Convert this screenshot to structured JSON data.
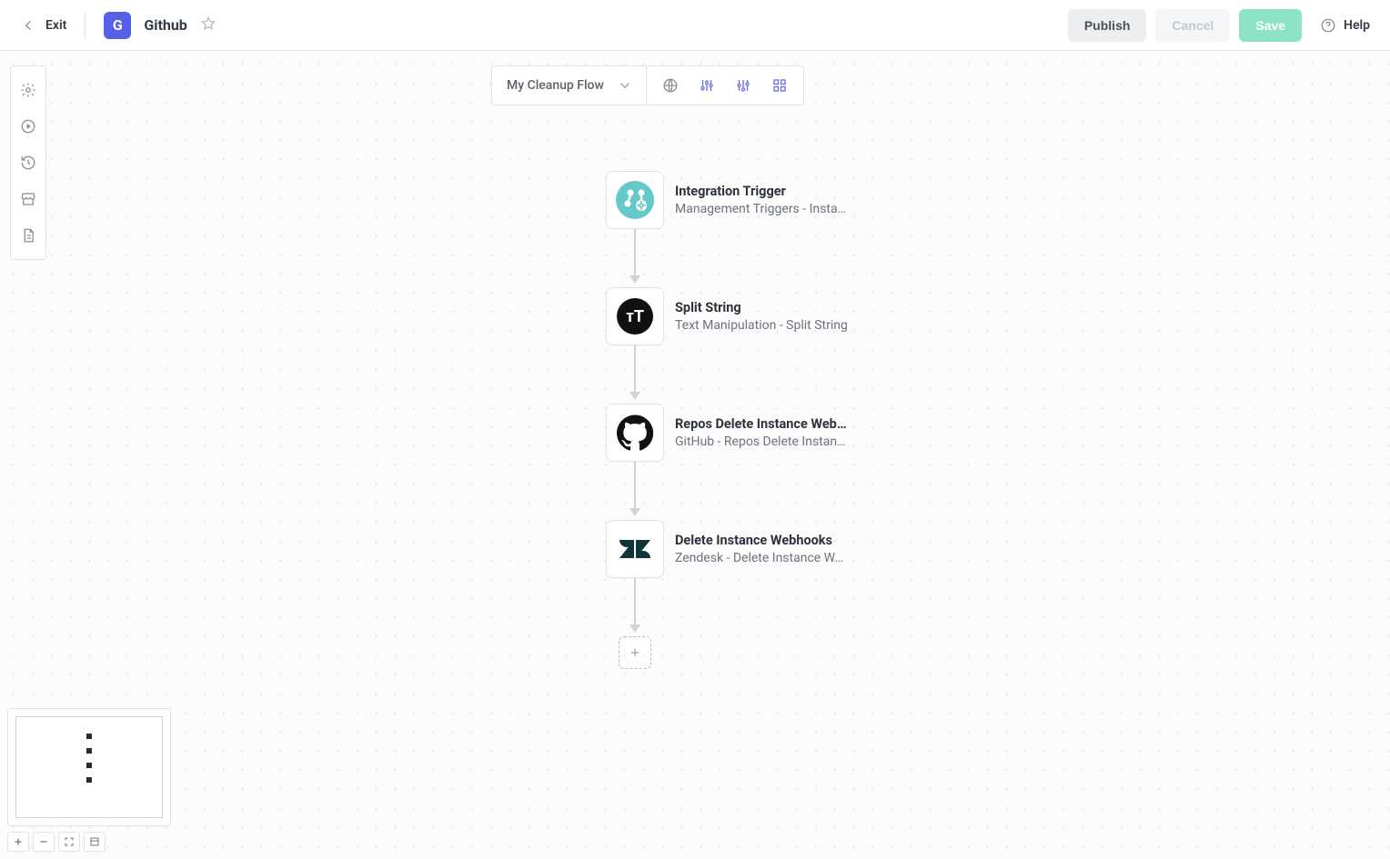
{
  "header": {
    "exit": "Exit",
    "badge": "G",
    "title": "Github",
    "publish": "Publish",
    "cancel": "Cancel",
    "save": "Save",
    "help": "Help"
  },
  "flow_select": {
    "label": "My Cleanup Flow"
  },
  "steps": [
    {
      "title": "Integration Trigger",
      "subtitle": "Management Triggers - Insta…",
      "icon": "integration"
    },
    {
      "title": "Split String",
      "subtitle": "Text Manipulation - Split String",
      "icon": "text"
    },
    {
      "title": "Repos Delete Instance Webho…",
      "subtitle": "GitHub - Repos Delete Instan…",
      "icon": "github"
    },
    {
      "title": "Delete Instance Webhooks",
      "subtitle": "Zendesk - Delete Instance We…",
      "icon": "zendesk"
    }
  ]
}
